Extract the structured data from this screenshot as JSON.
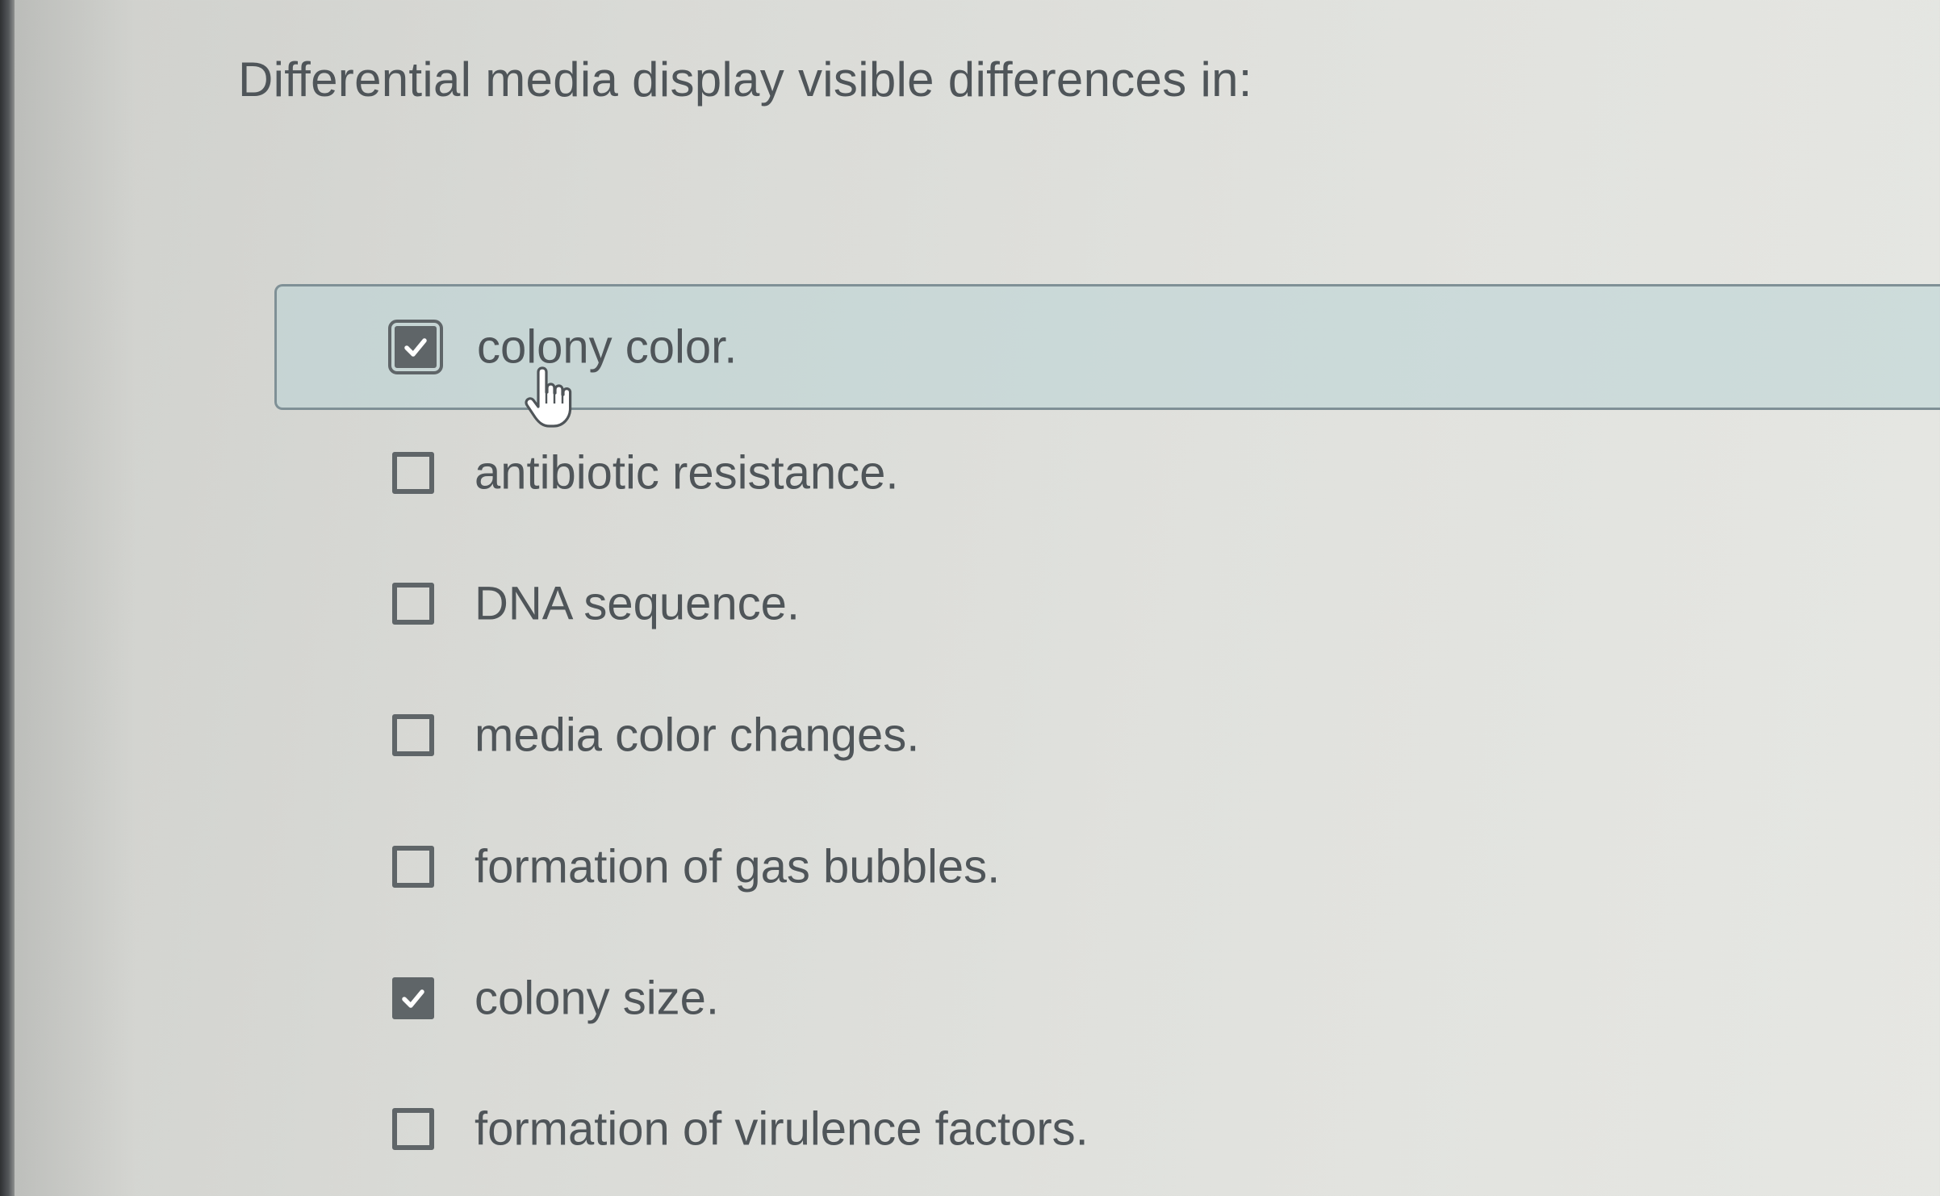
{
  "question": {
    "text": "Differential media display visible differences in:"
  },
  "options": [
    {
      "label": "colony color.",
      "checked": true,
      "highlighted": true
    },
    {
      "label": "antibiotic resistance.",
      "checked": false,
      "highlighted": false
    },
    {
      "label": "DNA sequence.",
      "checked": false,
      "highlighted": false
    },
    {
      "label": "media color changes.",
      "checked": false,
      "highlighted": false
    },
    {
      "label": "formation of gas bubbles.",
      "checked": false,
      "highlighted": false
    },
    {
      "label": "colony size.",
      "checked": true,
      "highlighted": false
    },
    {
      "label": "formation of virulence factors.",
      "checked": false,
      "highlighted": false
    }
  ],
  "colors": {
    "text": "#4f5559",
    "checkbox": "#5f6568",
    "highlight_bg": "#b9d4d6",
    "highlight_border": "#7f9096"
  },
  "icons": {
    "check": "checkmark-icon",
    "cursor": "hand-pointer-icon"
  }
}
